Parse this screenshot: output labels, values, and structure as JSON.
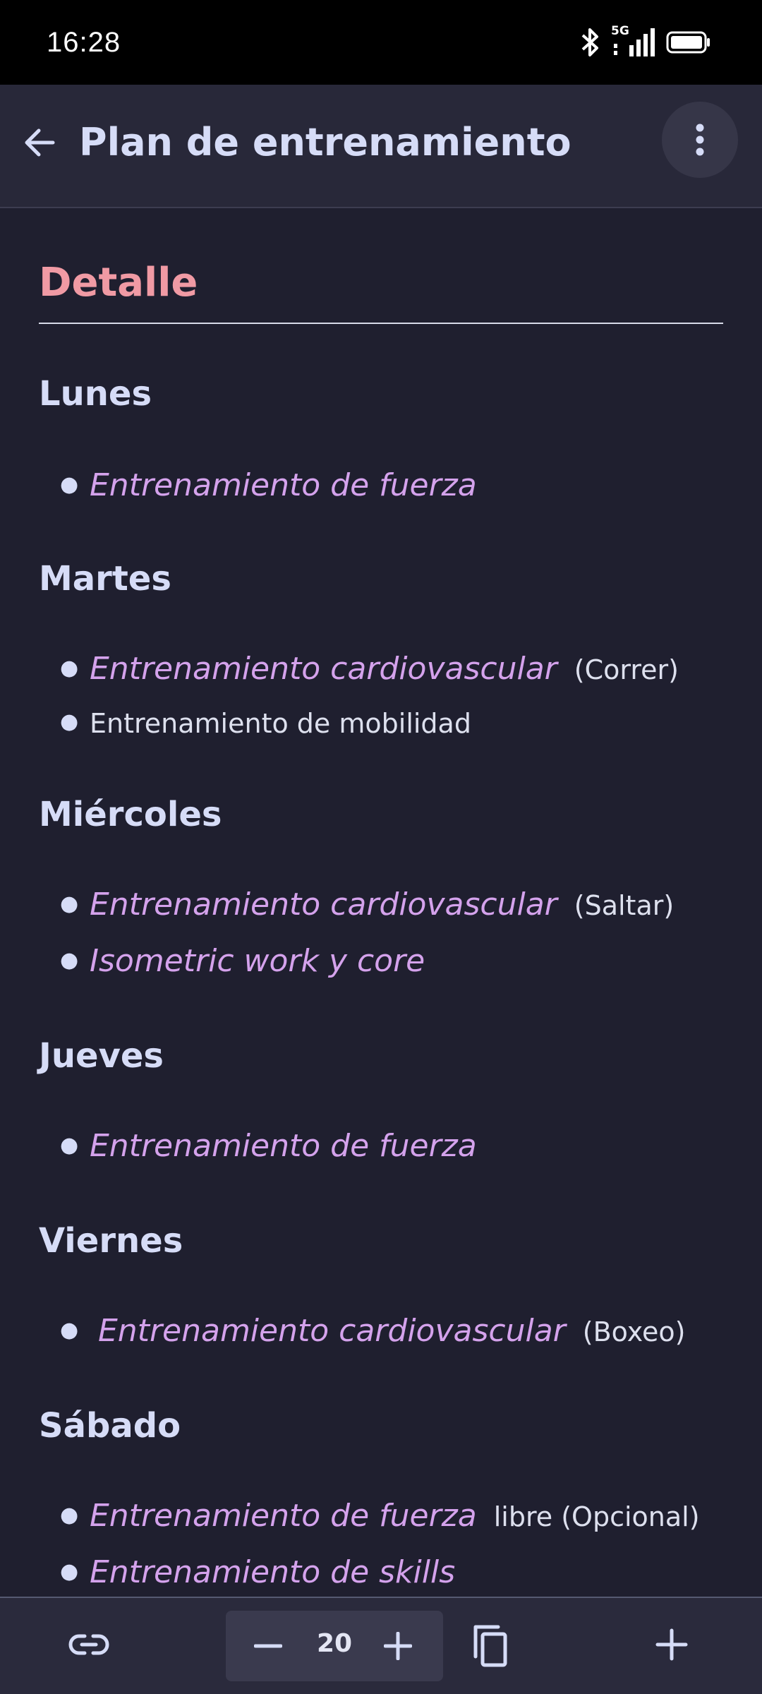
{
  "status_bar": {
    "time": "16:28",
    "network": "5G"
  },
  "app_bar": {
    "title": "Plan de entrenamiento"
  },
  "content": {
    "heading": "Detalle",
    "days": [
      {
        "name": "Lunes",
        "items": [
          {
            "link": "Entrenamiento de fuerza",
            "note": ""
          }
        ]
      },
      {
        "name": "Martes",
        "items": [
          {
            "link": "Entrenamiento cardiovascular",
            "note": "(Correr)"
          },
          {
            "link": "",
            "note": "Entrenamiento de mobilidad"
          }
        ]
      },
      {
        "name": "Miércoles",
        "items": [
          {
            "link": "Entrenamiento cardiovascular",
            "note": "(Saltar)"
          },
          {
            "link": "Isometric work y core",
            "note": ""
          }
        ]
      },
      {
        "name": "Jueves",
        "items": [
          {
            "link": "Entrenamiento de fuerza",
            "note": ""
          }
        ]
      },
      {
        "name": "Viernes",
        "items": [
          {
            "link": "Entrenamiento cardiovascular",
            "note": "(Boxeo)"
          }
        ]
      },
      {
        "name": "Sábado",
        "items": [
          {
            "link": "Entrenamiento de fuerza",
            "note": "libre (Opcional)"
          },
          {
            "link": "Entrenamiento de skills",
            "note": ""
          }
        ]
      }
    ]
  },
  "bottom_bar": {
    "font_size_value": "20"
  },
  "colors": {
    "accent_heading": "#f09aa4",
    "link": "#d4a2ec",
    "text": "#d6dcf7",
    "background": "#1f1f2f"
  }
}
